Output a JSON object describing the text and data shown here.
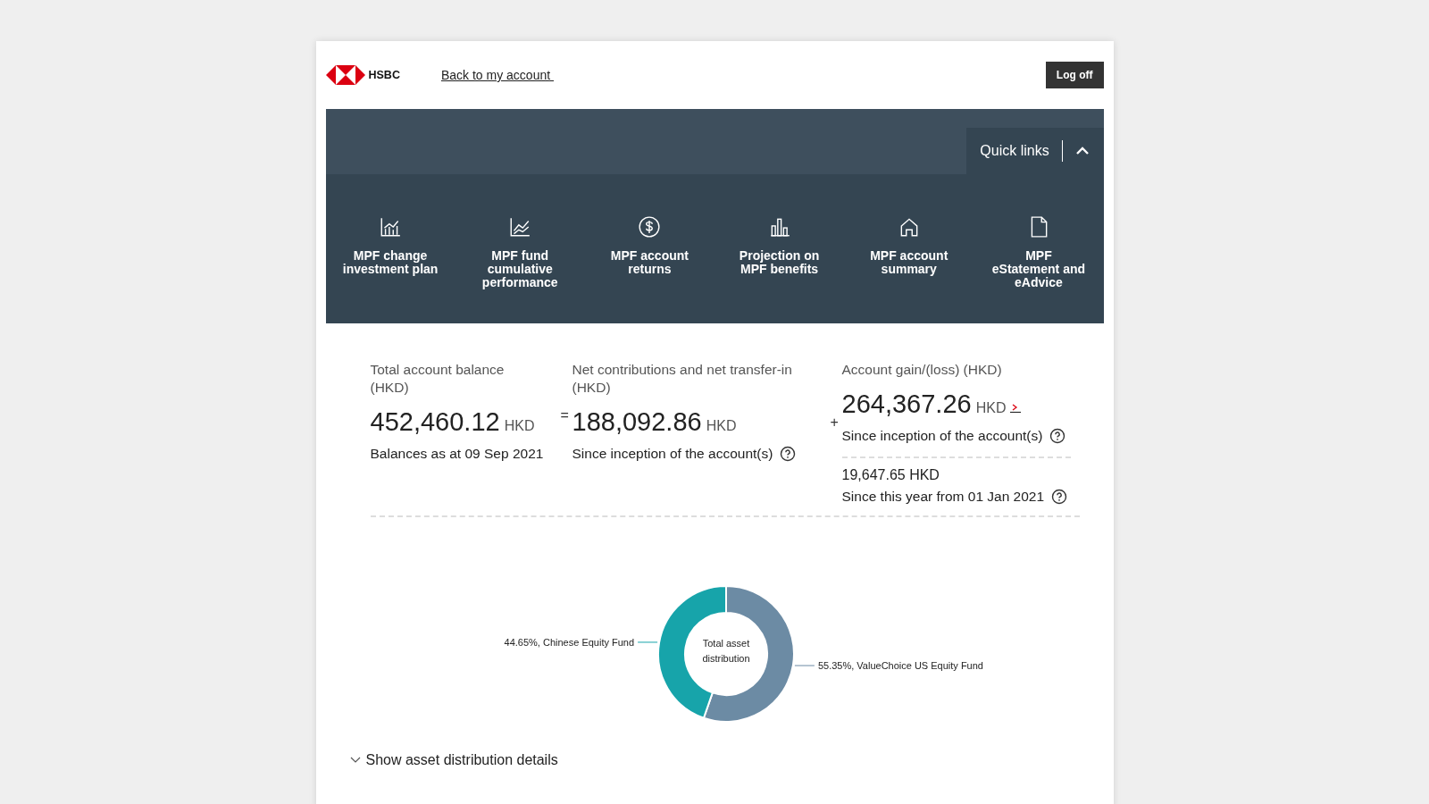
{
  "header": {
    "logo_text": "HSBC",
    "back_link": "Back to my account ",
    "logoff_button": "Log off"
  },
  "quick_links": {
    "title": "Quick links",
    "expanded": true,
    "items": [
      {
        "kind": "bar-chart",
        "label": "MPF change investment plan"
      },
      {
        "kind": "line-chart",
        "label": "MPF fund cumulative performance"
      },
      {
        "kind": "dollar",
        "label": "MPF account returns"
      },
      {
        "kind": "bars",
        "label": "Projection on MPF benefits"
      },
      {
        "kind": "home",
        "label": "MPF account summary"
      },
      {
        "kind": "document",
        "label": "MPF eStatement and eAdvice"
      }
    ]
  },
  "stats": [
    {
      "label": "Total account balance (HKD)",
      "amount": "452,460.12",
      "currency": "HKD",
      "has_link": false,
      "notes": [
        {
          "text": "Balances as at 09 Sep 2021",
          "help": false
        }
      ]
    },
    {
      "operator": "=",
      "label": "Net contributions and net transfer-in (HKD)",
      "amount": "188,092.86",
      "currency": "HKD",
      "has_link": false,
      "notes": [
        {
          "text": "Since inception of the account(s)",
          "help": true
        }
      ]
    },
    {
      "operator": "+",
      "label": "Account gain/(loss) (HKD)",
      "amount": "264,367.26",
      "currency": "HKD",
      "has_link": true,
      "notes": [
        {
          "text": "Since inception of the account(s)",
          "help": true
        }
      ],
      "year": {
        "amount": "19,647.65 HKD",
        "text": "Since this year from 01 Jan 2021",
        "help": true
      }
    }
  ],
  "chart_data": {
    "type": "donut",
    "title": "Total asset distribution",
    "values": [
      44.65,
      55.35
    ],
    "colors": [
      "#17a4aa",
      "#6c8ba4"
    ],
    "value_labels": [
      "44.65%, Chinese Equity Fund",
      "55.35%, ValueChoice US Equity Fund"
    ]
  },
  "details_toggle": {
    "label": "Show asset distribution details",
    "expanded": false
  }
}
